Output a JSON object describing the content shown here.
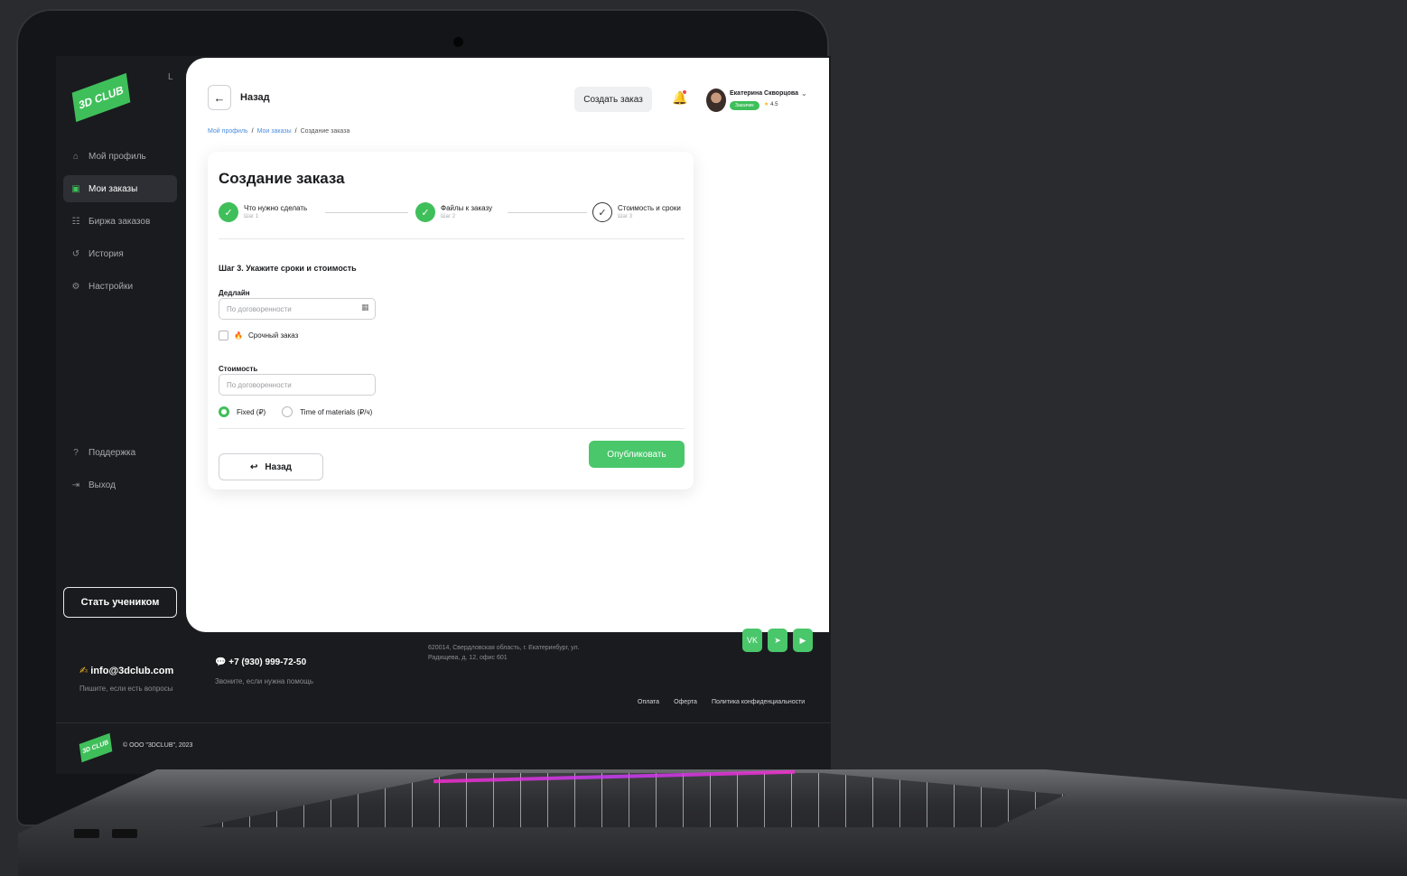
{
  "brand": {
    "logo_text": "3D CLUB",
    "accent": "#3fbf5a"
  },
  "sidebar": {
    "collapse_icon": "L",
    "items": [
      {
        "label": "Мой профиль",
        "icon": "home-icon",
        "glyph": "⌂"
      },
      {
        "label": "Мои заказы",
        "icon": "orders-icon",
        "glyph": "▣"
      },
      {
        "label": "Биржа заказов",
        "icon": "exchange-icon",
        "glyph": "☷"
      },
      {
        "label": "История",
        "icon": "history-icon",
        "glyph": "↺"
      },
      {
        "label": "Настройки",
        "icon": "settings-icon",
        "glyph": "⚙"
      },
      {
        "label": "Поддержка",
        "icon": "support-icon",
        "glyph": "?"
      },
      {
        "label": "Выход",
        "icon": "logout-icon",
        "glyph": "⇥"
      }
    ],
    "student_button": "Стать учеником"
  },
  "header": {
    "back_label": "Назад",
    "create_order_button": "Создать заказ",
    "user": {
      "name": "Екатерина Скворцова",
      "role_badge": "Заказчик",
      "rating": "4.5"
    }
  },
  "breadcrumb": {
    "items": [
      "Мой профиль",
      "Мои заказы",
      "Создание заказа"
    ]
  },
  "form": {
    "title": "Создание заказа",
    "steps": [
      {
        "label": "Что нужно сделать",
        "sub": "Шаг 1",
        "status": "done"
      },
      {
        "label": "Файлы к заказу",
        "sub": "Шаг 2",
        "status": "done"
      },
      {
        "label": "Стоимость и сроки",
        "sub": "Шаг 3",
        "status": "current"
      }
    ],
    "section_title": "Шаг 3. Укажите сроки и стоимость",
    "deadline": {
      "label": "Дедлайн",
      "placeholder": "По договоренности"
    },
    "urgent_label": "Срочный заказ",
    "cost": {
      "label": "Стоимость",
      "placeholder": "По договоренности"
    },
    "pricing": {
      "option_fixed": "Fixed (₽)",
      "option_tm": "Time of materials (₽/ч)",
      "selected": "fixed"
    },
    "back_button": "Назад",
    "publish_button": "Опубликовать"
  },
  "footer": {
    "email": "info@3dclub.com",
    "email_sub": "Пишите, если есть вопросы",
    "phone": "+7 (930) 999-72-50",
    "phone_sub": "Звоните, если нужна помощь",
    "address": "620014, Свердловская область, г. Екатеринбург, ул. Радищева, д. 12, офис 601",
    "socials": [
      "vk-icon",
      "telegram-icon",
      "youtube-icon"
    ],
    "links": [
      "Оплата",
      "Оферта",
      "Политика конфиденциальности"
    ],
    "copyright": "© ООО \"3DCLUB\", 2023"
  }
}
